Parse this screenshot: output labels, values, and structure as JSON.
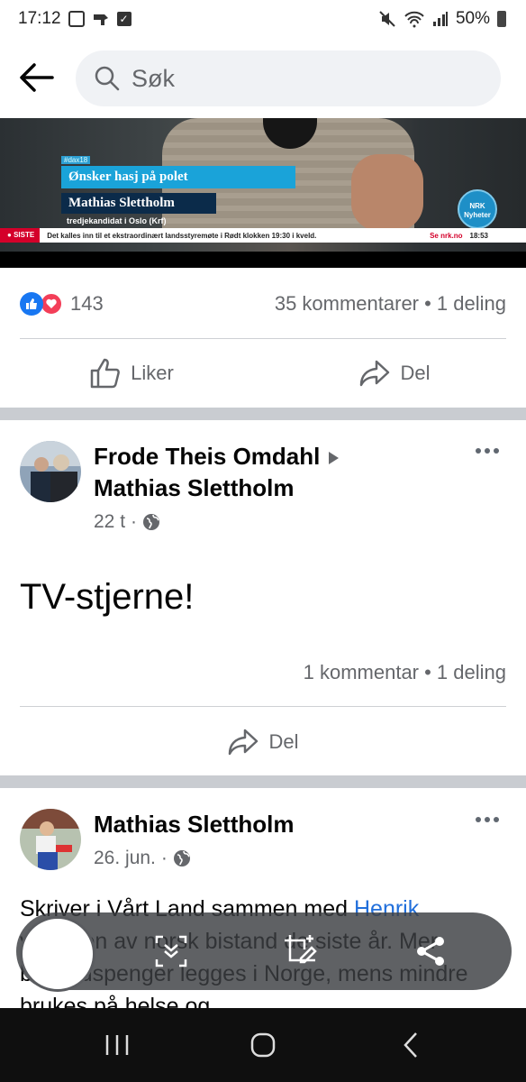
{
  "status_bar": {
    "time": "17:12",
    "battery": "50%"
  },
  "search": {
    "placeholder": "Søk"
  },
  "video_overlay": {
    "tag": "#dax18",
    "headline": "Ønsker hasj på polet",
    "name": "Mathias Slettholm",
    "subtitle": "tredjekandidat i Oslo (Krf)",
    "ticker_label": "SISTE",
    "ticker_text": "Det kalles inn til et ekstraordinært landsstyremøte i Rødt klokken 19:30 i kveld.",
    "ticker_link": "Se nrk.no",
    "ticker_time": "18:53",
    "logo_line1": "NRK",
    "logo_line2": "Nyheter"
  },
  "post1": {
    "reaction_count": "143",
    "stats": "35 kommentarer • 1 deling",
    "like_label": "Liker",
    "share_label": "Del"
  },
  "post2": {
    "author": "Frode Theis Omdahl",
    "target": "Mathias Slettholm",
    "time": "22 t",
    "text": "TV-stjerne!",
    "stats": "1 kommentar • 1 deling",
    "share_label": "Del"
  },
  "post3": {
    "author": "Mathias Slettholm",
    "time": "26. jun.",
    "text_before_link": "Skriver i Vårt Land sammen med ",
    "link": "Henrik",
    "text_after_link": " viklingen av norsk bistand de siste år. Mer bistandspenger legges i Norge, mens mindre brukes på helse og"
  },
  "colors": {
    "accent": "#1877f2",
    "love": "#f33e58",
    "link": "#216fdb"
  },
  "icons": [
    "back-arrow-icon",
    "search-icon",
    "like-icon",
    "share-icon",
    "globe-icon",
    "more-icon",
    "scroll-capture-icon",
    "edit-crop-icon",
    "share-nodes-icon",
    "recents-icon",
    "home-icon",
    "back-nav-icon"
  ]
}
